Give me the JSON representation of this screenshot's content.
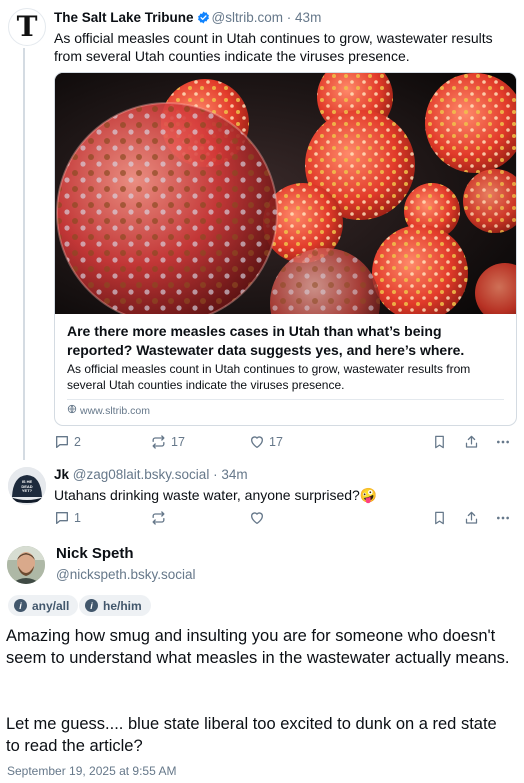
{
  "post1": {
    "author": "The Salt Lake Tribune",
    "handle": "@sltrib.com",
    "separator": "·",
    "age": "43m",
    "text": "As official measles count in Utah continues to grow, wastewater results from several Utah counties indicate the viruses presence.",
    "embed": {
      "title": "Are there more measles cases in Utah than what’s being reported? Wastewater data suggests yes, and here’s where.",
      "description": "As official measles count in Utah continues to grow, wastewater results from several Utah counties indicate the viruses presence.",
      "domain": "www.sltrib.com"
    },
    "replies": "2",
    "reposts": "17",
    "likes": "17",
    "avatar_letter": "T"
  },
  "post2": {
    "author": "Jk",
    "handle": "@zag08lait.bsky.social",
    "separator": "·",
    "age": "34m",
    "text": "Utahans drinking waste water, anyone surprised?🤪",
    "replies": "1",
    "avatar_hat_text": "IS HE DEAD YET?"
  },
  "main": {
    "author": "Nick Speth",
    "handle": "@nickspeth.bsky.social",
    "pills": [
      "any/all",
      "he/him"
    ],
    "paragraph1": "Amazing how smug and insulting you are for someone who doesn't seem to understand what measles in the wastewater actually means.",
    "paragraph2": "Let me guess.... blue state liberal too excited to dunk on a red state to read the article?",
    "timestamp": "September 19, 2025 at 9:55 AM"
  },
  "colors": {
    "text": "#0b0f14",
    "muted": "#66788a",
    "verified": "#1083fe",
    "border": "#d4dbe2"
  },
  "icons": [
    "reply-icon",
    "repost-icon",
    "like-icon",
    "bookmark-icon",
    "share-icon",
    "more-icon",
    "verified-icon",
    "globe-icon"
  ]
}
